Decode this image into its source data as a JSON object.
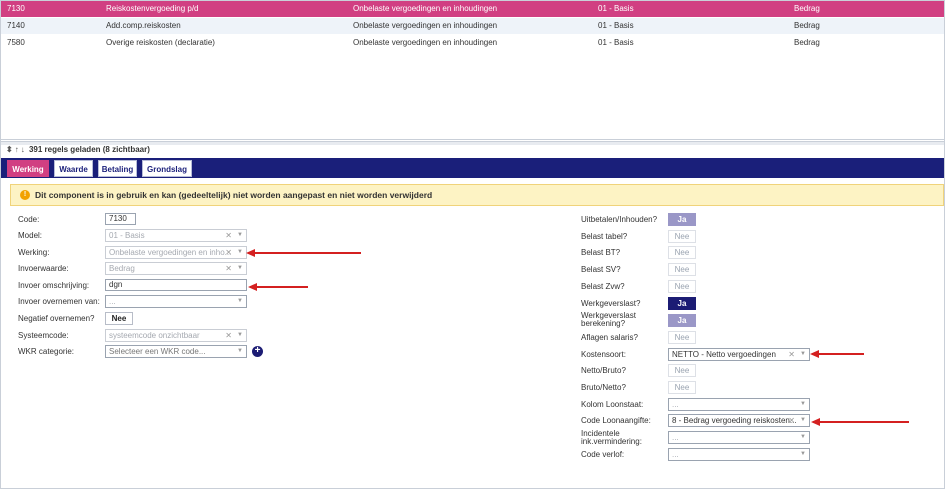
{
  "list": {
    "rows": [
      {
        "code": "7130",
        "name": "Reiskostenvergoeding p/d",
        "werking": "Onbelaste vergoedingen en inhoudingen",
        "model": "01 - Basis",
        "invoer": "Bedrag",
        "selected": true
      },
      {
        "code": "7140",
        "name": "Add.comp.reiskosten",
        "werking": "Onbelaste vergoedingen en inhoudingen",
        "model": "01 - Basis",
        "invoer": "Bedrag"
      },
      {
        "code": "7580",
        "name": "Overige reiskosten (declaratie)",
        "werking": "Onbelaste vergoedingen en inhoudingen",
        "model": "01 - Basis",
        "invoer": "Bedrag"
      }
    ]
  },
  "status": {
    "text": "391 regels geladen (8 zichtbaar)"
  },
  "tabs": [
    {
      "label": "Werking",
      "active": true
    },
    {
      "label": "Waarde"
    },
    {
      "label": "Betaling"
    },
    {
      "label": "Grondslag"
    }
  ],
  "warning": {
    "text": "Dit component is in gebruik en kan (gedeeltelijk) niet worden aangepast en niet worden verwijderd"
  },
  "form": {
    "code": {
      "label": "Code:",
      "value": "7130"
    },
    "model": {
      "label": "Model:",
      "value": "01 - Basis"
    },
    "werking": {
      "label": "Werking:",
      "value": "Onbelaste vergoedingen en inho..."
    },
    "invoerwaarde": {
      "label": "Invoerwaarde:",
      "value": "Bedrag"
    },
    "invoer_omschrijving": {
      "label": "Invoer omschrijving:",
      "value": "dgn"
    },
    "invoer_overnemen": {
      "label": "Invoer overnemen van:",
      "value": "..."
    },
    "negatief": {
      "label": "Negatief overnemen?",
      "value": "Nee"
    },
    "systeemcode": {
      "label": "Systeemcode:",
      "value": "systeemcode onzichtbaar"
    },
    "wkr": {
      "label": "WKR categorie:",
      "placeholder": "Selecteer een WKR code..."
    }
  },
  "right": {
    "uitbetalen": {
      "label": "Uitbetalen/Inhouden?",
      "value": "Ja"
    },
    "belast_tabel": {
      "label": "Belast tabel?",
      "value": "Nee"
    },
    "belast_bt": {
      "label": "Belast BT?",
      "value": "Nee"
    },
    "belast_sv": {
      "label": "Belast SV?",
      "value": "Nee"
    },
    "belast_zvw": {
      "label": "Belast Zvw?",
      "value": "Nee"
    },
    "werkgeverslast": {
      "label": "Werkgeverslast?",
      "value": "Ja"
    },
    "werkgeverslast_ber": {
      "label1": "Werkgeverslast",
      "label2": "berekening?",
      "value": "Ja"
    },
    "aflagen": {
      "label": "Aflagen salaris?",
      "value": "Nee"
    },
    "kostensoort": {
      "label": "Kostensoort:",
      "value": "NETTO - Netto vergoedingen"
    },
    "netto_bruto": {
      "label": "Netto/Bruto?",
      "value": "Nee"
    },
    "bruto_netto": {
      "label": "Bruto/Netto?",
      "value": "Nee"
    },
    "kolom": {
      "label": "Kolom Loonstaat:",
      "value": "..."
    },
    "code_loon": {
      "label": "Code Loonaangifte:",
      "value": "8 - Bedrag vergoeding reiskosten..."
    },
    "incidentele": {
      "label1": "Incidentele",
      "label2": "ink.vermindering:",
      "value": "..."
    },
    "code_verlof": {
      "label": "Code verlof:",
      "value": "..."
    }
  },
  "symbols": {
    "x": "✕",
    "dd": "▼",
    "plus": "+",
    "warn": "!",
    "sort": "⬍",
    "up": "↑",
    "down": "↓"
  },
  "colors": {
    "accent": "#d13f82",
    "navy": "#1a1f7a",
    "arrow": "#d42020"
  }
}
